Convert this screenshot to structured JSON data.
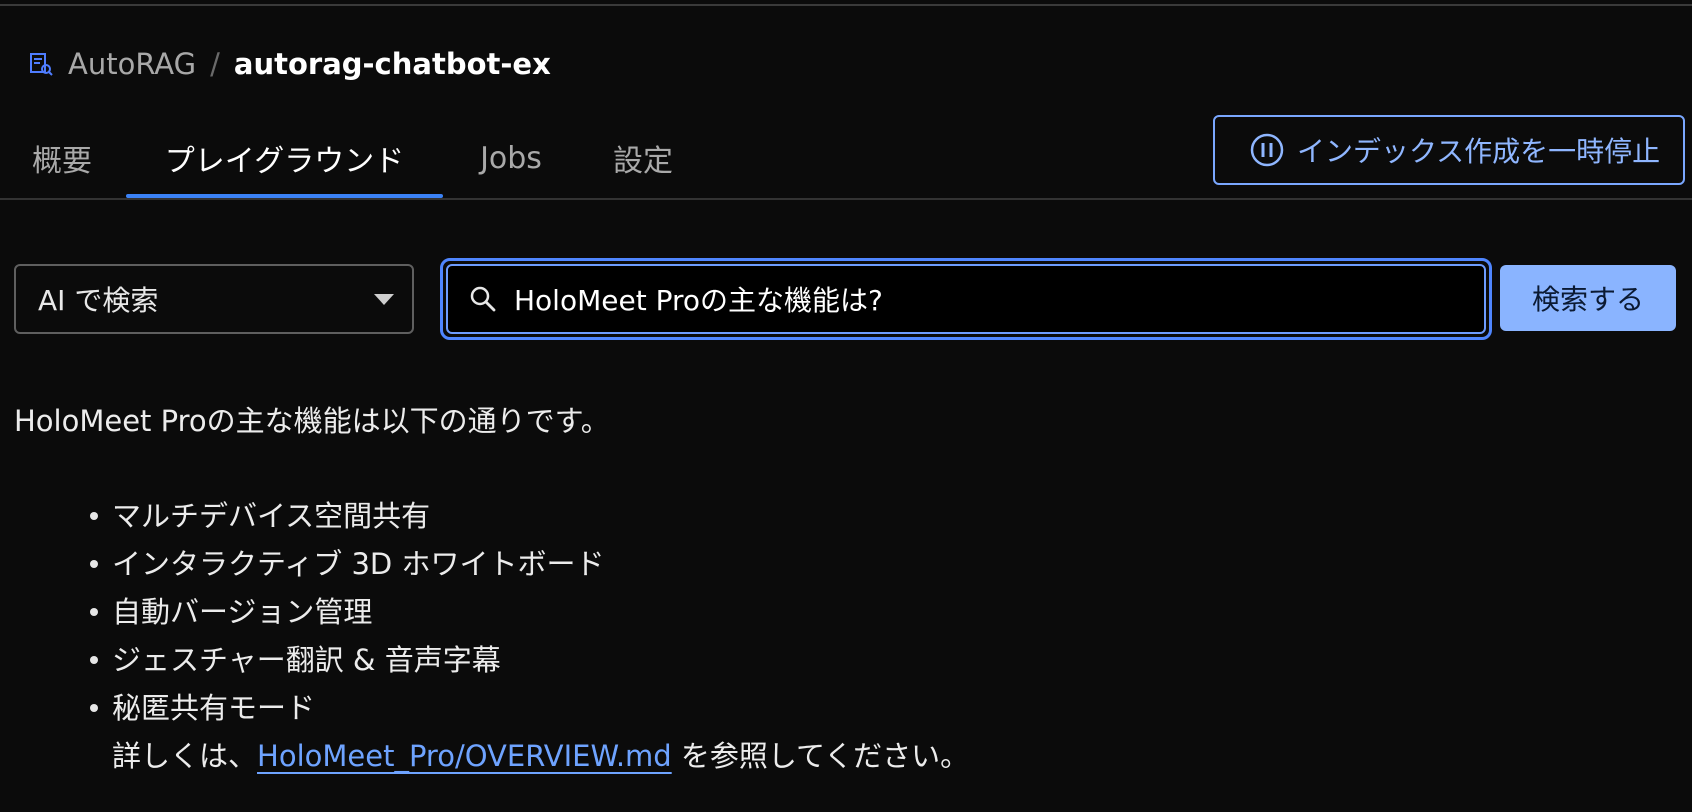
{
  "header": {
    "breadcrumb_root": "AutoRAG",
    "breadcrumb_sep": "/",
    "breadcrumb_current": "autorag-chatbot-ex"
  },
  "tabs": [
    {
      "label": "概要"
    },
    {
      "label": "プレイグラウンド",
      "active": true
    },
    {
      "label": "Jobs"
    },
    {
      "label": "設定"
    }
  ],
  "actions": {
    "pause_label": "インデックス作成を一時停止"
  },
  "search": {
    "mode_selected": "AI で検索",
    "query_value": "HoloMeet Proの主な機能は?",
    "submit_label": "検索する"
  },
  "answer": {
    "intro": "HoloMeet Proの主な機能は以下の通りです。",
    "features": [
      "マルチデバイス空間共有",
      "インタラクティブ 3D ホワイトボード",
      "自動バージョン管理",
      "ジェスチャー翻訳 & 音声字幕",
      "秘匿共有モード"
    ],
    "ref_prefix": "詳しくは、",
    "ref_link": "HoloMeet_Pro/OVERVIEW.md",
    "ref_suffix": " を参照してください。"
  },
  "colors": {
    "accent": "#3b82f6",
    "button_fill": "#8ab4ff",
    "link": "#6ea3ff",
    "background": "#0b0b0b"
  }
}
